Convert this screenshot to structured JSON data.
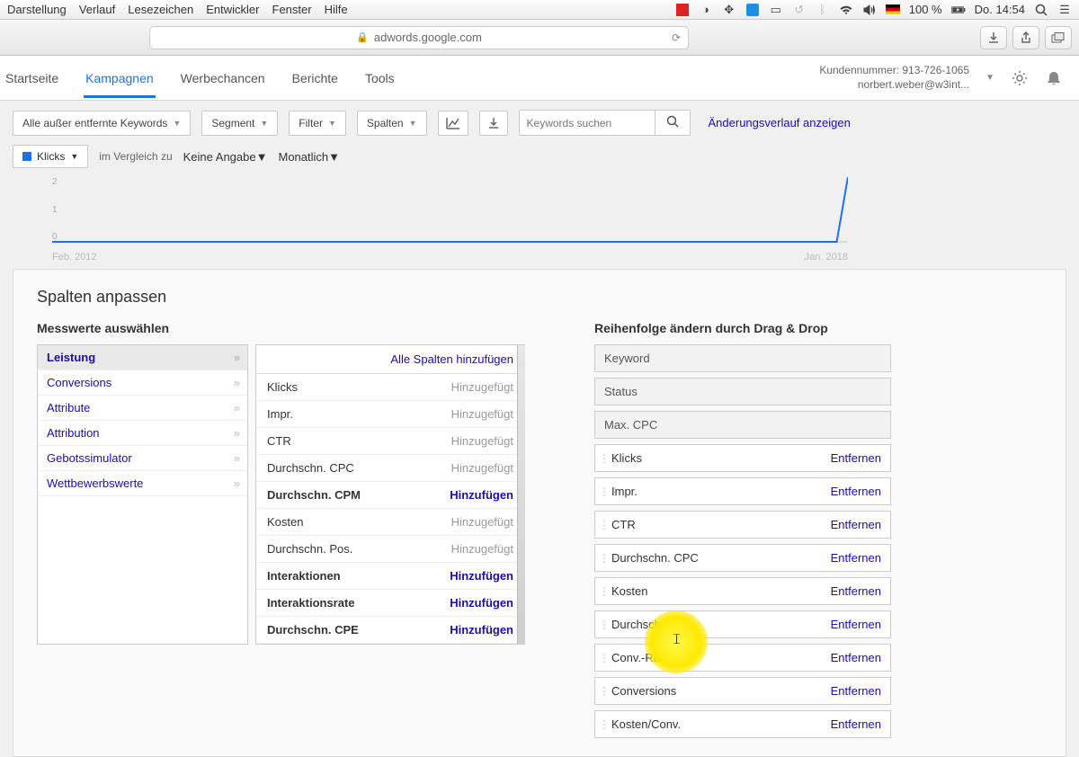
{
  "mac_menu": {
    "items": [
      "Darstellung",
      "Verlauf",
      "Lesezeichen",
      "Entwickler",
      "Fenster",
      "Hilfe"
    ],
    "battery": "100 %",
    "clock": "Do. 14:54"
  },
  "browser": {
    "url": "adwords.google.com"
  },
  "nav": {
    "tabs": [
      "Startseite",
      "Kampagnen",
      "Werbechancen",
      "Berichte",
      "Tools"
    ],
    "active_index": 1,
    "account_no_label": "Kundennummer: 913-726-1065",
    "account_email": "norbert.weber@w3int..."
  },
  "toolbar": {
    "keywords_btn": "Alle außer entfernte Keywords",
    "segment": "Segment",
    "filter": "Filter",
    "spalten": "Spalten",
    "search_placeholder": "Keywords suchen",
    "history_link": "Änderungsverlauf anzeigen"
  },
  "toolbar2": {
    "metric": "Klicks",
    "compare_label": "im Vergleich zu",
    "compare_value": "Keine Angabe",
    "period": "Monatlich"
  },
  "chart_data": {
    "type": "line",
    "title": "",
    "xlabel": "",
    "ylabel": "",
    "ylim": [
      0,
      2
    ],
    "yticks": [
      0,
      1,
      2
    ],
    "x_range_labels": [
      "Feb. 2012",
      "Jan. 2018"
    ],
    "series": [
      {
        "name": "Klicks",
        "color": "#1a73e8",
        "x_index": [
          0,
          1,
          2,
          3,
          4,
          5,
          6,
          7,
          8,
          9,
          10,
          11,
          12,
          13,
          14,
          15,
          16,
          17,
          18,
          19,
          20,
          21,
          22,
          23,
          24,
          25,
          26,
          27,
          28,
          29,
          30,
          31,
          32,
          33,
          34,
          35,
          36,
          37,
          38,
          39,
          40,
          41,
          42,
          43,
          44,
          45,
          46,
          47,
          48,
          49,
          50,
          51,
          52,
          53,
          54,
          55,
          56,
          57,
          58,
          59,
          60,
          61,
          62,
          63,
          64,
          65,
          66,
          67,
          68,
          69,
          70,
          71
        ],
        "values": [
          0,
          0,
          0,
          0,
          0,
          0,
          0,
          0,
          0,
          0,
          0,
          0,
          0,
          0,
          0,
          0,
          0,
          0,
          0,
          0,
          0,
          0,
          0,
          0,
          0,
          0,
          0,
          0,
          0,
          0,
          0,
          0,
          0,
          0,
          0,
          0,
          0,
          0,
          0,
          0,
          0,
          0,
          0,
          0,
          0,
          0,
          0,
          0,
          0,
          0,
          0,
          0,
          0,
          0,
          0,
          0,
          0,
          0,
          0,
          0,
          0,
          0,
          0,
          0,
          0,
          0,
          0,
          0,
          0,
          0,
          0,
          2
        ]
      }
    ]
  },
  "panel": {
    "title": "Spalten anpassen",
    "left_header": "Messwerte auswählen",
    "right_header": "Reihenfolge ändern durch Drag & Drop",
    "categories": [
      "Leistung",
      "Conversions",
      "Attribute",
      "Attribution",
      "Gebotssimulator",
      "Wettbewerbswerte"
    ],
    "active_cat_index": 0,
    "add_all": "Alle Spalten hinzufügen",
    "added_label": "Hinzugefügt",
    "add_label": "Hinzufügen",
    "remove_label": "Entfernen",
    "metrics": [
      {
        "name": "Klicks",
        "added": true
      },
      {
        "name": "Impr.",
        "added": true
      },
      {
        "name": "CTR",
        "added": true
      },
      {
        "name": "Durchschn. CPC",
        "added": true
      },
      {
        "name": "Durchschn. CPM",
        "added": false
      },
      {
        "name": "Kosten",
        "added": true
      },
      {
        "name": "Durchschn. Pos.",
        "added": true
      },
      {
        "name": "Interaktionen",
        "added": false
      },
      {
        "name": "Interaktionsrate",
        "added": false
      },
      {
        "name": "Durchschn. CPE",
        "added": false
      }
    ],
    "order_locked": [
      "Keyword",
      "Status",
      "Max. CPC"
    ],
    "order_movable": [
      "Klicks",
      "Impr.",
      "CTR",
      "Durchschn. CPC",
      "Kosten",
      "Durchschn. Pos.",
      "Conv.-Rate",
      "Conversions",
      "Kosten/Conv."
    ]
  }
}
